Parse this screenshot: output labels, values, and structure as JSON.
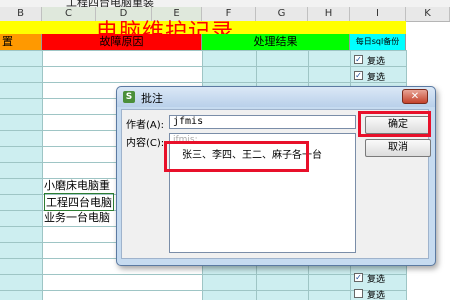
{
  "formula_bar": {
    "text": "工程四台电脑重装"
  },
  "columns": [
    "B",
    "C",
    "D",
    "E",
    "F",
    "G",
    "H",
    "I",
    "K"
  ],
  "sheet": {
    "title": "电脑维护记录",
    "headers": {
      "col_b": "置",
      "col_cde": "故障原因",
      "col_fgh": "处理结果",
      "col_i": "每日sql备份"
    },
    "cells": [
      "小磨床电脑重",
      "工程四台电脑",
      "业务一台电脑"
    ],
    "checkbox_label": "复选",
    "checkboxes_top": [
      true,
      true,
      false,
      false
    ],
    "checkboxes_bottom": [
      true,
      false
    ]
  },
  "dialog": {
    "title": "批注",
    "author_label": "作者(A):",
    "author_value": "jfmis",
    "content_label": "内容(C):",
    "content_faint": "jfmis:",
    "content_text": "张三、李四、王二、麻子各一台",
    "ok_label": "确定",
    "cancel_label": "取消",
    "close_glyph": "✕"
  },
  "colors": {
    "title_red": "#ff0000",
    "highlight_red": "#e8102a",
    "header_orange": "#ff9900",
    "header_red": "#ff0000",
    "header_green": "#00ff00",
    "header_cyan": "#00ffff",
    "row_cyan": "#cdeef0"
  }
}
